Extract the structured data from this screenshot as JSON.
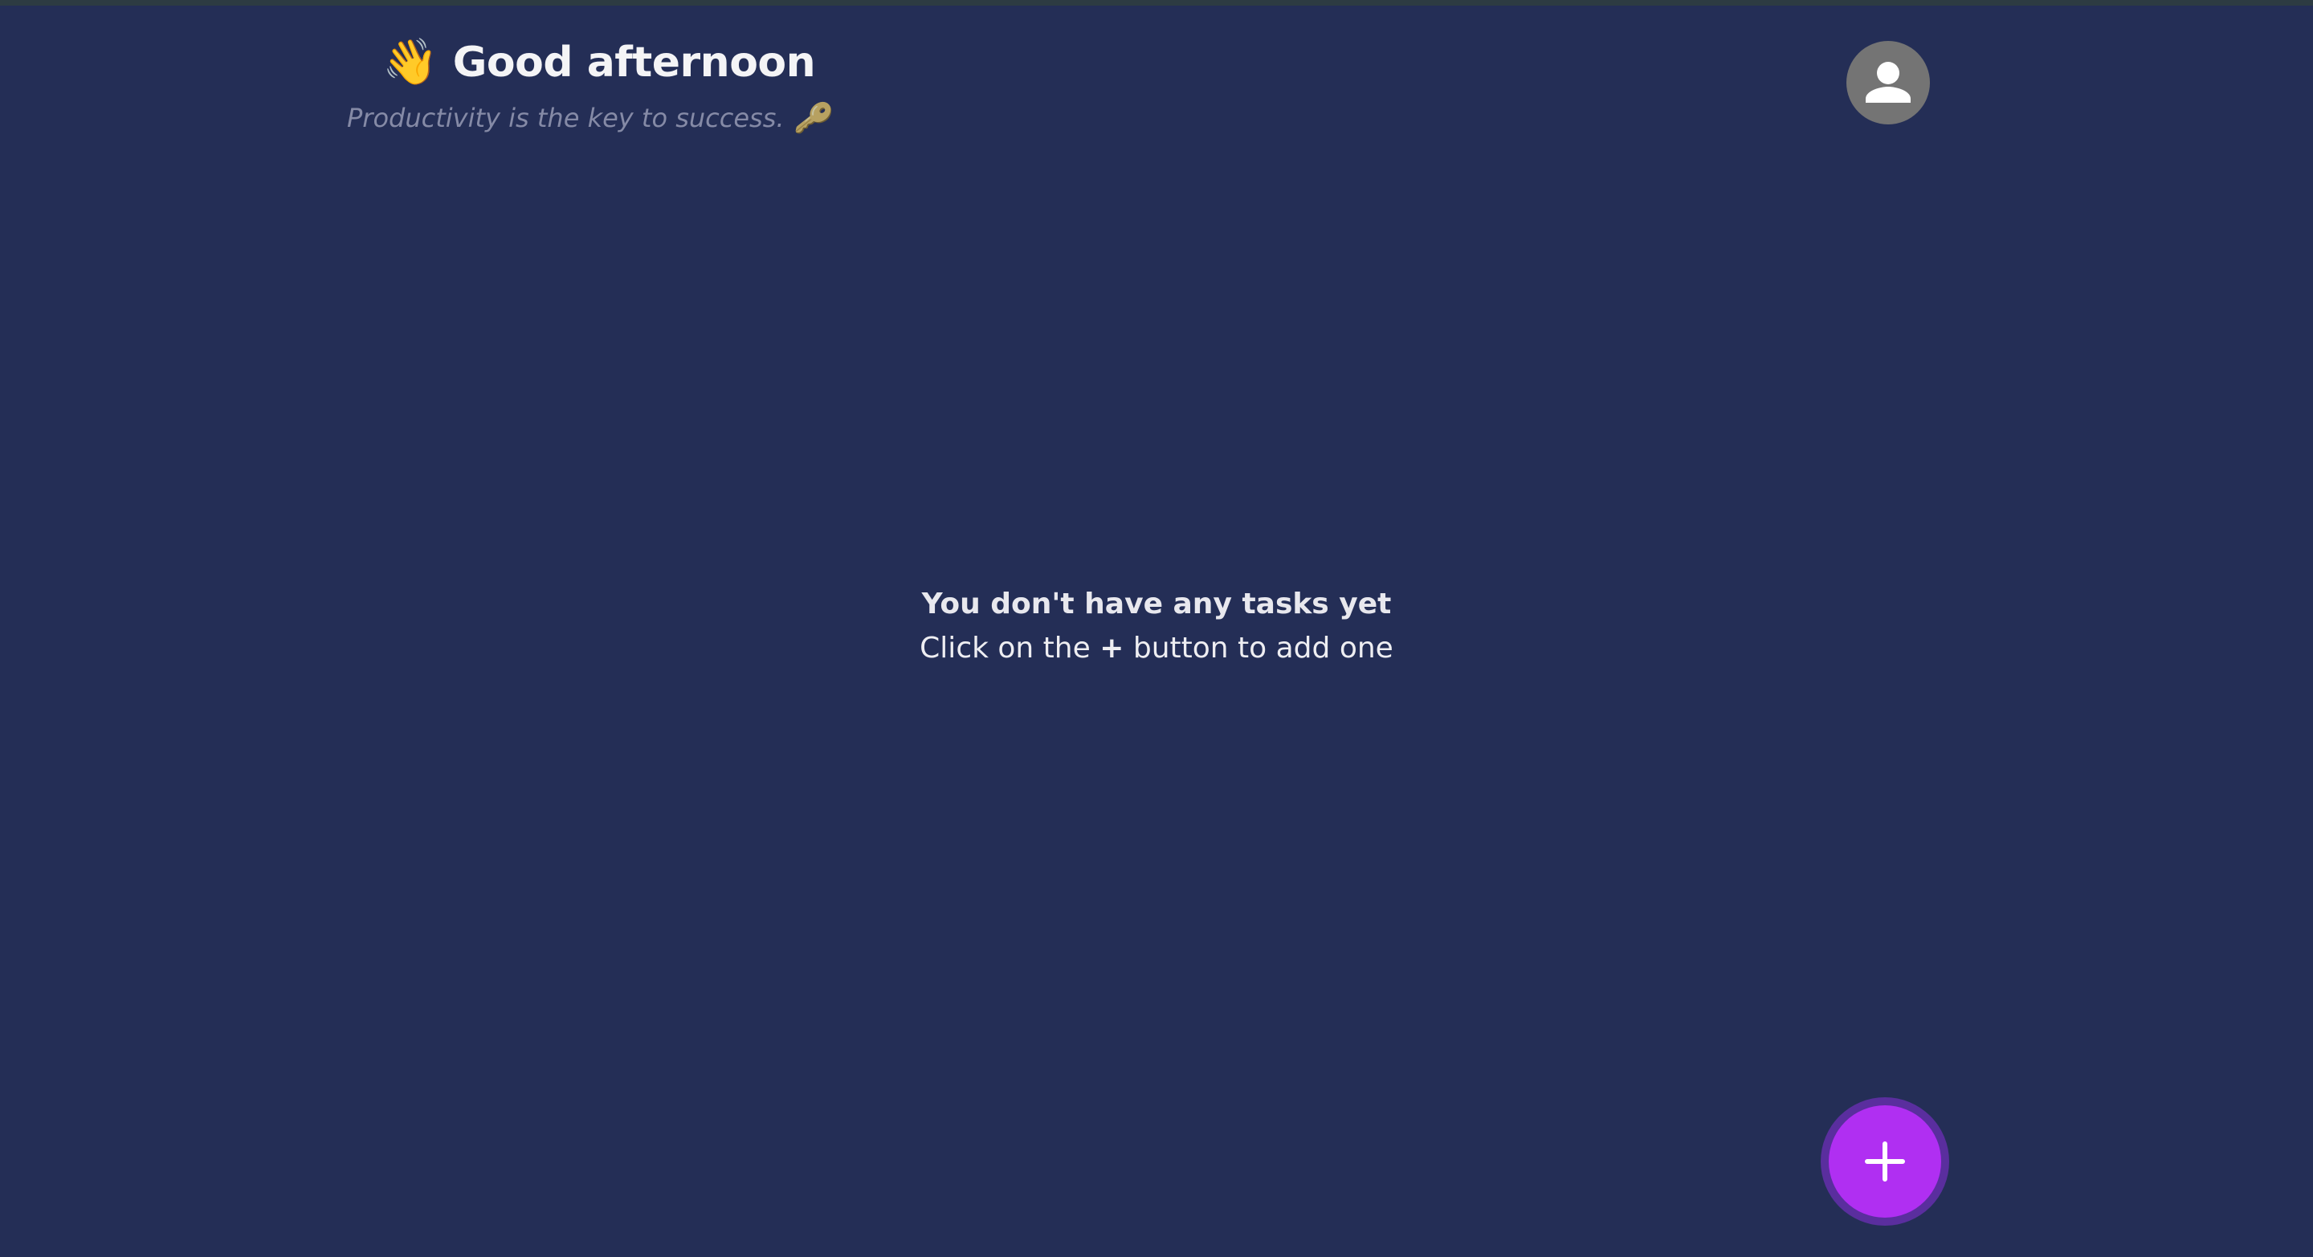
{
  "header": {
    "greeting_emoji": "👋",
    "greeting": "Good afternoon",
    "subtitle": "Productivity is the key to success.",
    "subtitle_emoji": "🔑"
  },
  "avatar": {
    "icon": "user-icon"
  },
  "empty_state": {
    "title": "You don't have any tasks yet",
    "line_prefix": "Click on the",
    "line_symbol": "+",
    "line_suffix": "button to add one"
  },
  "fab": {
    "icon": "plus-icon",
    "color": "#b02ff2"
  }
}
